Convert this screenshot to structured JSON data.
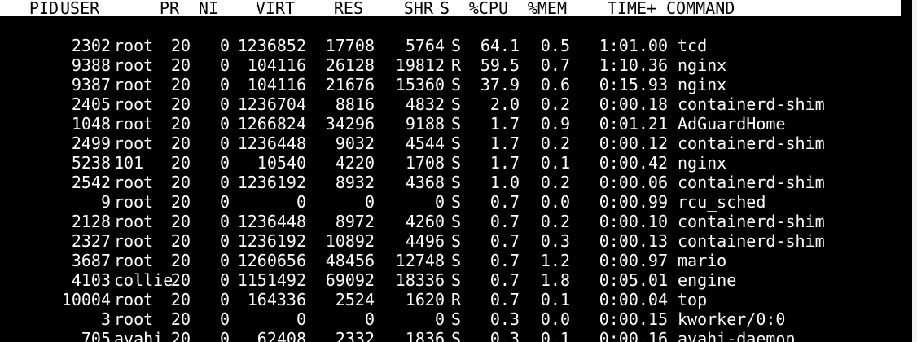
{
  "process_table": {
    "headers": {
      "pid": "PID",
      "user": "USER",
      "pr": "PR",
      "ni": "NI",
      "virt": "VIRT",
      "res": "RES",
      "shr": "SHR",
      "s": "S",
      "cpu": "%CPU",
      "mem": "%MEM",
      "time": "TIME+",
      "command": "COMMAND"
    },
    "rows": [
      {
        "pid": "2302",
        "user": "root",
        "pr": "20",
        "ni": "0",
        "virt": "1236852",
        "res": "17708",
        "shr": "5764",
        "s": "S",
        "cpu": "64.1",
        "mem": "0.5",
        "time": "1:01.00",
        "command": "tcd"
      },
      {
        "pid": "9388",
        "user": "root",
        "pr": "20",
        "ni": "0",
        "virt": "104116",
        "res": "26128",
        "shr": "19812",
        "s": "R",
        "cpu": "59.5",
        "mem": "0.7",
        "time": "1:10.36",
        "command": "nginx"
      },
      {
        "pid": "9387",
        "user": "root",
        "pr": "20",
        "ni": "0",
        "virt": "104116",
        "res": "21676",
        "shr": "15360",
        "s": "S",
        "cpu": "37.9",
        "mem": "0.6",
        "time": "0:15.93",
        "command": "nginx"
      },
      {
        "pid": "2405",
        "user": "root",
        "pr": "20",
        "ni": "0",
        "virt": "1236704",
        "res": "8816",
        "shr": "4832",
        "s": "S",
        "cpu": "2.0",
        "mem": "0.2",
        "time": "0:00.18",
        "command": "containerd-shim"
      },
      {
        "pid": "1048",
        "user": "root",
        "pr": "20",
        "ni": "0",
        "virt": "1266824",
        "res": "34296",
        "shr": "9188",
        "s": "S",
        "cpu": "1.7",
        "mem": "0.9",
        "time": "0:01.21",
        "command": "AdGuardHome"
      },
      {
        "pid": "2499",
        "user": "root",
        "pr": "20",
        "ni": "0",
        "virt": "1236448",
        "res": "9032",
        "shr": "4544",
        "s": "S",
        "cpu": "1.7",
        "mem": "0.2",
        "time": "0:00.12",
        "command": "containerd-shim"
      },
      {
        "pid": "5238",
        "user": "101",
        "pr": "20",
        "ni": "0",
        "virt": "10540",
        "res": "4220",
        "shr": "1708",
        "s": "S",
        "cpu": "1.7",
        "mem": "0.1",
        "time": "0:00.42",
        "command": "nginx"
      },
      {
        "pid": "2542",
        "user": "root",
        "pr": "20",
        "ni": "0",
        "virt": "1236192",
        "res": "8932",
        "shr": "4368",
        "s": "S",
        "cpu": "1.0",
        "mem": "0.2",
        "time": "0:00.06",
        "command": "containerd-shim"
      },
      {
        "pid": "9",
        "user": "root",
        "pr": "20",
        "ni": "0",
        "virt": "0",
        "res": "0",
        "shr": "0",
        "s": "S",
        "cpu": "0.7",
        "mem": "0.0",
        "time": "0:00.99",
        "command": "rcu_sched"
      },
      {
        "pid": "2128",
        "user": "root",
        "pr": "20",
        "ni": "0",
        "virt": "1236448",
        "res": "8972",
        "shr": "4260",
        "s": "S",
        "cpu": "0.7",
        "mem": "0.2",
        "time": "0:00.10",
        "command": "containerd-shim"
      },
      {
        "pid": "2327",
        "user": "root",
        "pr": "20",
        "ni": "0",
        "virt": "1236192",
        "res": "10892",
        "shr": "4496",
        "s": "S",
        "cpu": "0.7",
        "mem": "0.3",
        "time": "0:00.13",
        "command": "containerd-shim"
      },
      {
        "pid": "3687",
        "user": "root",
        "pr": "20",
        "ni": "0",
        "virt": "1260656",
        "res": "48456",
        "shr": "12748",
        "s": "S",
        "cpu": "0.7",
        "mem": "1.2",
        "time": "0:00.97",
        "command": "mario"
      },
      {
        "pid": "4103",
        "user": "collie",
        "pr": "20",
        "ni": "0",
        "virt": "1151492",
        "res": "69092",
        "shr": "18336",
        "s": "S",
        "cpu": "0.7",
        "mem": "1.8",
        "time": "0:05.01",
        "command": "engine"
      },
      {
        "pid": "10004",
        "user": "root",
        "pr": "20",
        "ni": "0",
        "virt": "164336",
        "res": "2524",
        "shr": "1620",
        "s": "R",
        "cpu": "0.7",
        "mem": "0.1",
        "time": "0:00.04",
        "command": "top"
      },
      {
        "pid": "3",
        "user": "root",
        "pr": "20",
        "ni": "0",
        "virt": "0",
        "res": "0",
        "shr": "0",
        "s": "S",
        "cpu": "0.3",
        "mem": "0.0",
        "time": "0:00.15",
        "command": "kworker/0:0"
      },
      {
        "pid": "705",
        "user": "avahi",
        "pr": "20",
        "ni": "0",
        "virt": "62408",
        "res": "2332",
        "shr": "1836",
        "s": "S",
        "cpu": "0.3",
        "mem": "0.1",
        "time": "0:00.16",
        "command": "avahi-daemon"
      }
    ]
  },
  "colors": {
    "terminal_background": "#000000",
    "terminal_text": "#ffffff",
    "header_background": "#ffffff",
    "header_text": "#000000"
  }
}
